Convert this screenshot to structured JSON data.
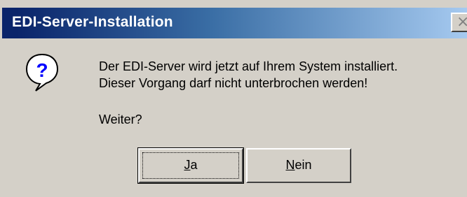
{
  "window": {
    "title": "EDI-Server-Installation",
    "close_glyph": "×"
  },
  "message": {
    "line1": "Der EDI-Server wird jetzt auf Ihrem System installiert.",
    "line2": "Dieser Vorgang darf nicht unterbrochen werden!",
    "question": "Weiter?"
  },
  "icon": {
    "name": "question-icon",
    "glyph": "?",
    "color": "#0000ff"
  },
  "buttons": {
    "yes": {
      "accel": "J",
      "rest": "a"
    },
    "no": {
      "accel": "N",
      "rest": "ein"
    }
  },
  "colors": {
    "face": "#d4d0c8",
    "title_start": "#0a246a",
    "title_end": "#a6caf0"
  }
}
